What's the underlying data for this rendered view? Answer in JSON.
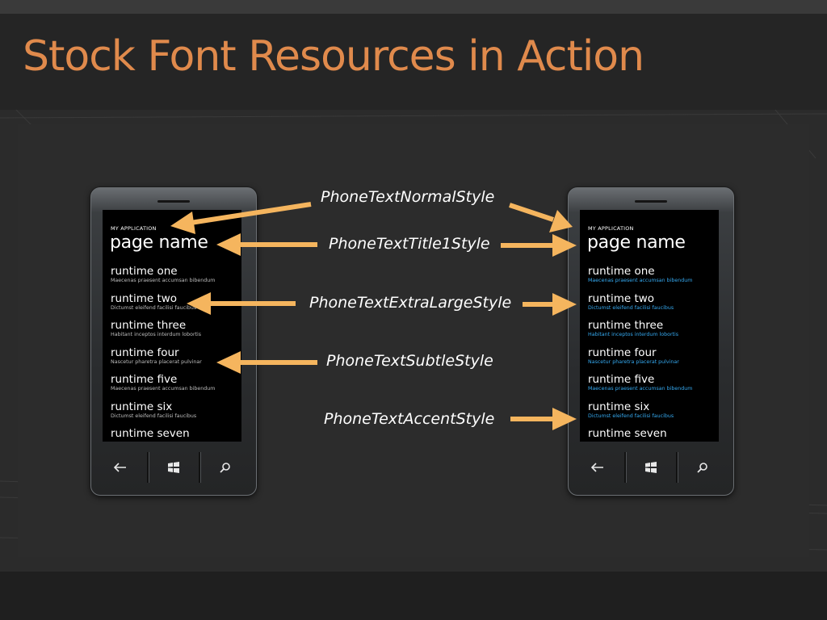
{
  "slide": {
    "title": "Stock Font Resources in Action"
  },
  "phone": {
    "app_title": "MY APPLICATION",
    "page_name": "page name",
    "items": [
      {
        "title": "runtime one",
        "subtitle": "Maecenas praesent accumsan bibendum"
      },
      {
        "title": "runtime two",
        "subtitle": "Dictumst eleifend facilisi faucibus"
      },
      {
        "title": "runtime three",
        "subtitle": "Habitant inceptos interdum lobortis"
      },
      {
        "title": "runtime four",
        "subtitle": "Nascetur pharetra placerat pulvinar"
      },
      {
        "title": "runtime five",
        "subtitle": "Maecenas praesent accumsan bibendum"
      },
      {
        "title": "runtime six",
        "subtitle": "Dictumst eleifend facilisi faucibus"
      },
      {
        "title": "runtime seven",
        "subtitle": ""
      }
    ],
    "buttons": {
      "back_icon": "back-arrow-icon",
      "start_icon": "windows-logo-icon",
      "search_icon": "search-icon"
    }
  },
  "captions": {
    "normal": "PhoneTextNormalStyle",
    "title1": "PhoneTextTitle1Style",
    "extralarge": "PhoneTextExtraLargeStyle",
    "subtle": "PhoneTextSubtleStyle",
    "accent": "PhoneTextAccentStyle"
  },
  "colors": {
    "title": "#e08a4c",
    "arrow": "#f5b55e",
    "accent_text": "#35a9f0",
    "background": "#2b2b2b"
  }
}
